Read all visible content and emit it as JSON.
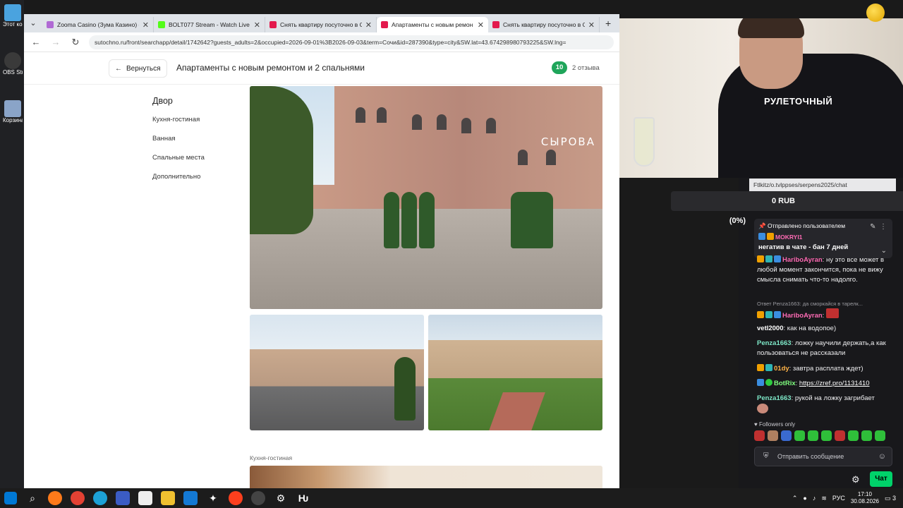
{
  "desktop": {
    "icons": [
      {
        "name": "Этот компьютер",
        "color": "#4aa3df"
      },
      {
        "name": "OBS Studio",
        "color": "#3a3a3a"
      },
      {
        "name": "Корзина",
        "color": "#8aa4c8"
      }
    ]
  },
  "browser": {
    "tabs": [
      {
        "title": "Zooma Casino (Зума Казино) о",
        "color": "#b06ad4",
        "active": false
      },
      {
        "title": "BOLT077 Stream - Watch Live o",
        "color": "#53fc18",
        "active": false
      },
      {
        "title": "Снять квартиру посуточно в С",
        "color": "#e3194d",
        "active": false
      },
      {
        "title": "Апартаменты с новым ремон",
        "color": "#e3194d",
        "active": true
      },
      {
        "title": "Снять квартиру посуточно в С",
        "color": "#e3194d",
        "active": false
      }
    ],
    "close_glyph": "✕",
    "new_tab_glyph": "+",
    "url": "sutochno.ru/front/searchapp/detail/1742642?guests_adults=2&occupied=2026-09-01%3B2026-09-03&term=Сочи&id=287390&type=city&SW.lat=43.674298980793225&SW.lng="
  },
  "page": {
    "back_label": "Вернуться",
    "title": "Апартаменты с новым ремонтом и 2 спальнями",
    "rating": "10",
    "reviews": "2 отзыва",
    "sidenav": {
      "heading": "Двор",
      "items": [
        "Кухня-гостиная",
        "Ванная",
        "Спальные места",
        "Дополнительно"
      ]
    },
    "photo_sign": "СЫРОВА",
    "section_label": "Кухня-гостиная"
  },
  "stream": {
    "shirt_text": "РУЛЕТОЧНЫЙ",
    "overlay_url": "Ftlkitz/o.tvlppses/serpens2025/chat",
    "balance": "0 RUB (0%)"
  },
  "chat": {
    "pinned_header": "Отправлено пользователем",
    "pinned_user": "MOKRYI1",
    "pinned_text": "негатив в чате - бан 7 дней",
    "messages": [
      {
        "user": "HariboAyran",
        "color": "#ff6bb5",
        "text": ": ну это все может в любой момент закончится, пока не вижу смысла снимать что-то надолго."
      },
      {
        "reply": "Ответ Penza1663: да сморкайся в тарелк..."
      },
      {
        "user": "HariboAyran",
        "color": "#ff6bb5",
        "text": ":"
      },
      {
        "user": "vetl2000",
        "color": "#ffffff",
        "text": ": как на водопое)"
      },
      {
        "user": "Penza1663",
        "color": "#7ee8c8",
        "text": ": ложку научили держать,а как пользоваться не рассказали"
      },
      {
        "user": "01dy",
        "color": "#ffb347",
        "text": ": завтра расплата ждет)"
      },
      {
        "user": "BotRix",
        "color": "#7fff7f",
        "text": ":",
        "link": "https://zref.pro/1131410"
      },
      {
        "user": "Penza1663",
        "color": "#7ee8c8",
        "text": ": рукой на ложку загрибает"
      }
    ],
    "followers_only": "Followers only",
    "input_placeholder": "Отправить сообщение",
    "chat_button": "Чат"
  },
  "taskbar": {
    "lang": "РУС",
    "time": "17:10",
    "date": "30.08.2026",
    "notifications": "3"
  }
}
